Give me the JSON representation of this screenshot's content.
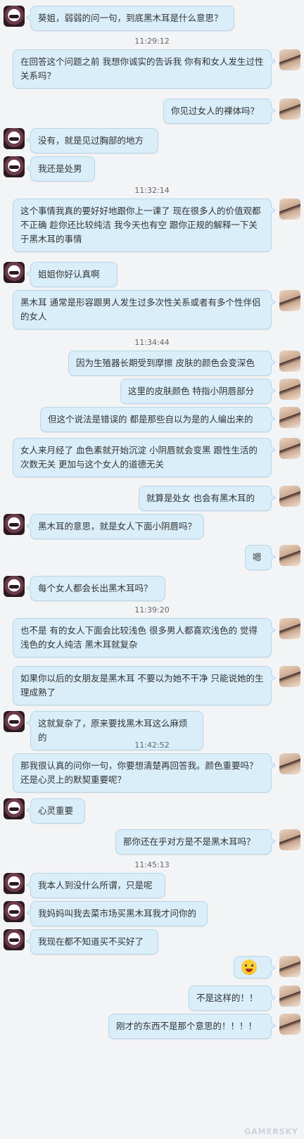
{
  "watermark": "GAMERSKY",
  "messages": [
    {
      "type": "msg",
      "side": "left",
      "text": "葵姐，弱弱的问一句，到底黑木耳是什么意思？"
    },
    {
      "type": "time",
      "text": "11:29:12"
    },
    {
      "type": "msg",
      "side": "right",
      "text": "在回答这个问题之前  我想你诚实的告诉我  你有和女人发生过性关系吗？"
    },
    {
      "type": "msg",
      "side": "right",
      "text": "你见过女人的裸体吗？"
    },
    {
      "type": "msg",
      "side": "left",
      "text": "没有，就是见过胸部的地方"
    },
    {
      "type": "msg",
      "side": "left",
      "text": "我还是处男"
    },
    {
      "type": "time",
      "text": "11:32:14"
    },
    {
      "type": "msg",
      "side": "right",
      "text": "这个事情我真的要好好地跟你上一课了  现在很多人的价值观都不正确  趁你还比较纯洁  我今天也有空  跟你正规的解释一下关于黑木耳的事情"
    },
    {
      "type": "msg",
      "side": "left",
      "text": "姐姐你好认真啊"
    },
    {
      "type": "msg",
      "side": "right",
      "text": "黑木耳  通常是形容跟男人发生过多次性关系或者有多个性伴侣的女人"
    },
    {
      "type": "time",
      "text": "11:34:44"
    },
    {
      "type": "msg",
      "side": "right",
      "text": "因为生殖器长期受到摩擦  皮肤的颜色会变深色"
    },
    {
      "type": "msg",
      "side": "right",
      "text": "这里的皮肤颜色  特指小阴唇部分"
    },
    {
      "type": "msg",
      "side": "right",
      "text": "但这个说法是错误的  都是那些自以为是的人编出来的"
    },
    {
      "type": "msg",
      "side": "right",
      "text": "女人来月经了  血色素就开始沉淀  小阴唇就会变黑  跟性生活的次数无关  更加与这个女人的道德无关"
    },
    {
      "type": "msg",
      "side": "right",
      "text": "就算是处女  也会有黑木耳的"
    },
    {
      "type": "msg",
      "side": "left",
      "text": "黑木耳的意思，就是女人下面小阴唇吗？"
    },
    {
      "type": "msg",
      "side": "right",
      "text": "嗯"
    },
    {
      "type": "msg",
      "side": "left",
      "text": "每个女人都会长出黑木耳吗？"
    },
    {
      "type": "time",
      "text": "11:39:20"
    },
    {
      "type": "msg",
      "side": "right",
      "text": "也不是  有的女人下面会比较浅色  很多男人都喜欢浅色的  觉得浅色的女人纯洁  黑木耳就复杂"
    },
    {
      "type": "msg",
      "side": "right",
      "text": "如果你以后的女朋友是黑木耳  不要以为她不干净  只能说她的生理成熟了"
    },
    {
      "type": "msg",
      "side": "left",
      "text": "这就复杂了，原来要找黑木耳这么麻烦的"
    },
    {
      "type": "time",
      "text": "11:42:52"
    },
    {
      "type": "msg",
      "side": "right",
      "text": "那我很认真的问你一句，你要想清楚再回答我。颜色重要吗？还是心灵上的默契重要呢？"
    },
    {
      "type": "msg",
      "side": "left",
      "text": "心灵重要"
    },
    {
      "type": "msg",
      "side": "right",
      "text": "那你还在乎对方是不是黑木耳吗？"
    },
    {
      "type": "time",
      "text": "11:45:13"
    },
    {
      "type": "msg",
      "side": "left",
      "text": "我本人到没什么所谓，只是呢"
    },
    {
      "type": "msg",
      "side": "left",
      "text": "我妈妈叫我去菜市场买黑木耳我才问你的"
    },
    {
      "type": "msg",
      "side": "left",
      "text": "我现在都不知道买不买好了"
    },
    {
      "type": "msg",
      "side": "right",
      "text": "",
      "emoji": "angry-face-emoji"
    },
    {
      "type": "msg",
      "side": "right",
      "text": "不是这样的！！"
    },
    {
      "type": "msg",
      "side": "right",
      "text": "刚才的东西不是那个意思的！！！！"
    }
  ]
}
